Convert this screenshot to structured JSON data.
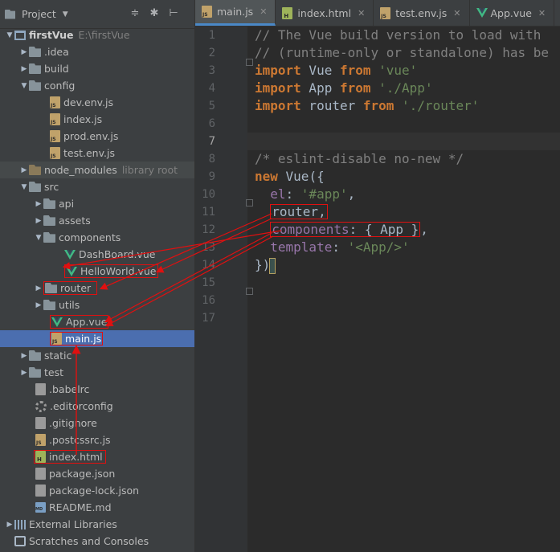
{
  "project_panel": {
    "title": "Project",
    "dropdown_glyph": "▼",
    "tools": {
      "collapse_glyph": "≑",
      "settings_glyph": "✱",
      "hide_glyph": "⊢"
    },
    "tree": [
      {
        "label": "firstVue",
        "extra": "E:\\firstVue",
        "icon": "project-icon",
        "arrow": "▼"
      },
      {
        "label": ".idea",
        "icon": "folder-icon",
        "arrow": "▶"
      },
      {
        "label": "build",
        "icon": "folder-icon",
        "arrow": "▶"
      },
      {
        "label": "config",
        "icon": "folder-icon",
        "arrow": "▼"
      },
      {
        "label": "dev.env.js",
        "icon": "js-file-icon"
      },
      {
        "label": "index.js",
        "icon": "js-file-icon"
      },
      {
        "label": "prod.env.js",
        "icon": "js-file-icon"
      },
      {
        "label": "test.env.js",
        "icon": "js-file-icon"
      },
      {
        "label": "node_modules",
        "extra": "library root",
        "icon": "folder-icon",
        "arrow": "▶"
      },
      {
        "label": "src",
        "icon": "folder-icon",
        "arrow": "▼"
      },
      {
        "label": "api",
        "icon": "folder-icon",
        "arrow": "▶"
      },
      {
        "label": "assets",
        "icon": "folder-icon",
        "arrow": "▶"
      },
      {
        "label": "components",
        "icon": "folder-icon",
        "arrow": "▼"
      },
      {
        "label": "DashBoard.vue",
        "icon": "vue-file-icon"
      },
      {
        "label": "HelloWorld.vue",
        "icon": "vue-file-icon"
      },
      {
        "label": "router",
        "icon": "folder-icon",
        "arrow": "▶"
      },
      {
        "label": "utils",
        "icon": "folder-icon",
        "arrow": "▶"
      },
      {
        "label": "App.vue",
        "icon": "vue-file-icon"
      },
      {
        "label": "main.js",
        "icon": "js-file-icon"
      },
      {
        "label": "static",
        "icon": "folder-icon",
        "arrow": "▶"
      },
      {
        "label": "test",
        "icon": "folder-icon",
        "arrow": "▶"
      },
      {
        "label": ".babelrc",
        "icon": "config-file-icon"
      },
      {
        "label": ".editorconfig",
        "icon": "gear-file-icon"
      },
      {
        "label": ".gitignore",
        "icon": "config-file-icon"
      },
      {
        "label": ".postcssrc.js",
        "icon": "js-file-icon"
      },
      {
        "label": "index.html",
        "icon": "html-file-icon"
      },
      {
        "label": "package.json",
        "icon": "config-file-icon"
      },
      {
        "label": "package-lock.json",
        "icon": "config-file-icon"
      },
      {
        "label": "README.md",
        "icon": "md-file-icon"
      },
      {
        "label": "External Libraries",
        "icon": "library-icon",
        "arrow": "▶"
      },
      {
        "label": "Scratches and Consoles",
        "icon": "scratch-icon"
      }
    ]
  },
  "editor": {
    "tabs": [
      {
        "label": "main.js",
        "icon": "js-file-icon",
        "active": true
      },
      {
        "label": "index.html",
        "icon": "html-file-icon"
      },
      {
        "label": "test.env.js",
        "icon": "js-file-icon"
      },
      {
        "label": "App.vue",
        "icon": "vue-file-icon"
      }
    ],
    "close_glyph": "✕",
    "line_numbers": [
      "1",
      "2",
      "3",
      "4",
      "5",
      "6",
      "7",
      "8",
      "9",
      "10",
      "11",
      "12",
      "13",
      "14",
      "15",
      "16",
      "17"
    ],
    "code": {
      "l1": "// The Vue build version to load with",
      "l2": "// (runtime-only or standalone) has be",
      "import": "import",
      "from": "from",
      "vue_name": " Vue ",
      "vue_str": "'vue'",
      "app_name": " App ",
      "app_str": "'./App'",
      "router_name": " router ",
      "router_str": "'./router'",
      "l8": "/* eslint-disable no-new */",
      "new": "new",
      "new_rest": " Vue({",
      "el_key": "el",
      "el_colon": ": ",
      "el_val": "'#app'",
      "comma": ",",
      "router_prop": "router",
      "components_key": "components",
      "components_val": ": { App }",
      "template_key": "template",
      "template_colon": ": ",
      "template_val": "'<App/>'",
      "close": "})"
    }
  },
  "colors": {
    "annotation": "#e01010",
    "selection": "#4b6eaf"
  }
}
